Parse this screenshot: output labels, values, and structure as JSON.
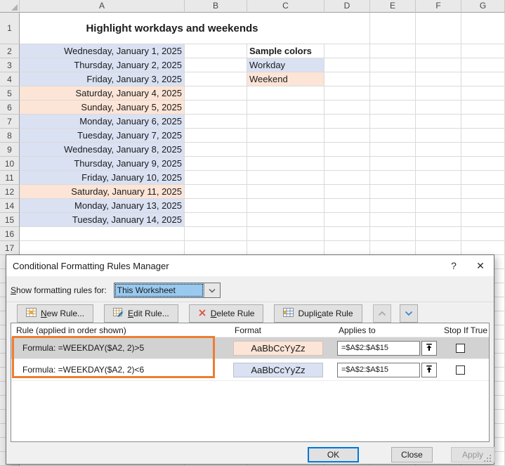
{
  "colors": {
    "workday_fill": "#D9E1F2",
    "weekend_fill": "#FCE4D6",
    "selected_row": "#D2D2D2",
    "annotation_orange": "#ED7D31",
    "ok_border_blue": "#0078D7",
    "combo_selection_blue": "#99C9EF"
  },
  "spreadsheet": {
    "column_headers": [
      "A",
      "B",
      "C",
      "D",
      "E",
      "F",
      "G"
    ],
    "title": "Highlight workdays and weekends",
    "rows": [
      {
        "num": "1",
        "title_row": true
      },
      {
        "num": "2",
        "date": "Wednesday, January 1, 2025",
        "type": "workday",
        "c_text": "Sample colors",
        "c_bold": true
      },
      {
        "num": "3",
        "date": "Thursday, January 2, 2025",
        "type": "workday",
        "c_text": "Workday",
        "c_fill": "workday"
      },
      {
        "num": "4",
        "date": "Friday, January 3, 2025",
        "type": "workday",
        "c_text": "Weekend",
        "c_fill": "weekend"
      },
      {
        "num": "5",
        "date": "Saturday, January 4, 2025",
        "type": "weekend"
      },
      {
        "num": "6",
        "date": "Sunday, January 5, 2025",
        "type": "weekend"
      },
      {
        "num": "7",
        "date": "Monday, January 6, 2025",
        "type": "workday"
      },
      {
        "num": "8",
        "date": "Tuesday, January 7, 2025",
        "type": "workday"
      },
      {
        "num": "9",
        "date": "Wednesday, January 8, 2025",
        "type": "workday"
      },
      {
        "num": "10",
        "date": "Thursday, January 9, 2025",
        "type": "workday"
      },
      {
        "num": "11",
        "date": "Friday, January 10, 2025",
        "type": "workday"
      },
      {
        "num": "12",
        "date": "Saturday, January 11, 2025",
        "type": "weekend"
      },
      {
        "num": "14",
        "date": "Monday, January 13, 2025",
        "type": "workday"
      },
      {
        "num": "15",
        "date": "Tuesday, January 14, 2025",
        "type": "workday"
      },
      {
        "num": "16"
      },
      {
        "num": "17"
      }
    ]
  },
  "dialog": {
    "title": "Conditional Formatting Rules Manager",
    "help_label": "?",
    "close_label": "✕",
    "scope_label": "Show formatting rules for:",
    "scope_label_underline_index": 0,
    "scope_value": "This Worksheet",
    "toolbar": [
      {
        "id": "new-rule",
        "label": "New Rule...",
        "underline": 0,
        "icon": "new-rule-table-icon"
      },
      {
        "id": "edit-rule",
        "label": "Edit Rule...",
        "underline": 0,
        "icon": "edit-rule-pencil-icon"
      },
      {
        "id": "delete-rule",
        "label": "Delete Rule",
        "underline": 0,
        "icon": "delete-red-x-icon"
      },
      {
        "id": "duplicate-rule",
        "label": "Duplicate Rule",
        "underline": 5,
        "icon": "duplicate-rule-table-icon"
      },
      {
        "id": "move-rule-up",
        "icon": "chevron-up-icon",
        "disabled": true
      },
      {
        "id": "move-rule-down",
        "icon": "chevron-down-icon",
        "disabled": false
      }
    ],
    "list_headers": [
      "Rule (applied in order shown)",
      "Format",
      "Applies to",
      "Stop If True"
    ],
    "rules": [
      {
        "rule_text": "Formula: =WEEKDAY($A2, 2)>5",
        "format_sample": "AaBbCcYyZz",
        "format_fill": "#FCE4D6",
        "applies_to": "=$A$2:$A$15",
        "stop_if_true": false,
        "selected": true
      },
      {
        "rule_text": "Formula: =WEEKDAY($A2, 2)<6",
        "format_sample": "AaBbCcYyZz",
        "format_fill": "#D9E1F2",
        "applies_to": "=$A$2:$A$15",
        "stop_if_true": false,
        "selected": false
      }
    ],
    "buttons": {
      "ok": "OK",
      "close": "Close",
      "apply": "Apply"
    }
  }
}
